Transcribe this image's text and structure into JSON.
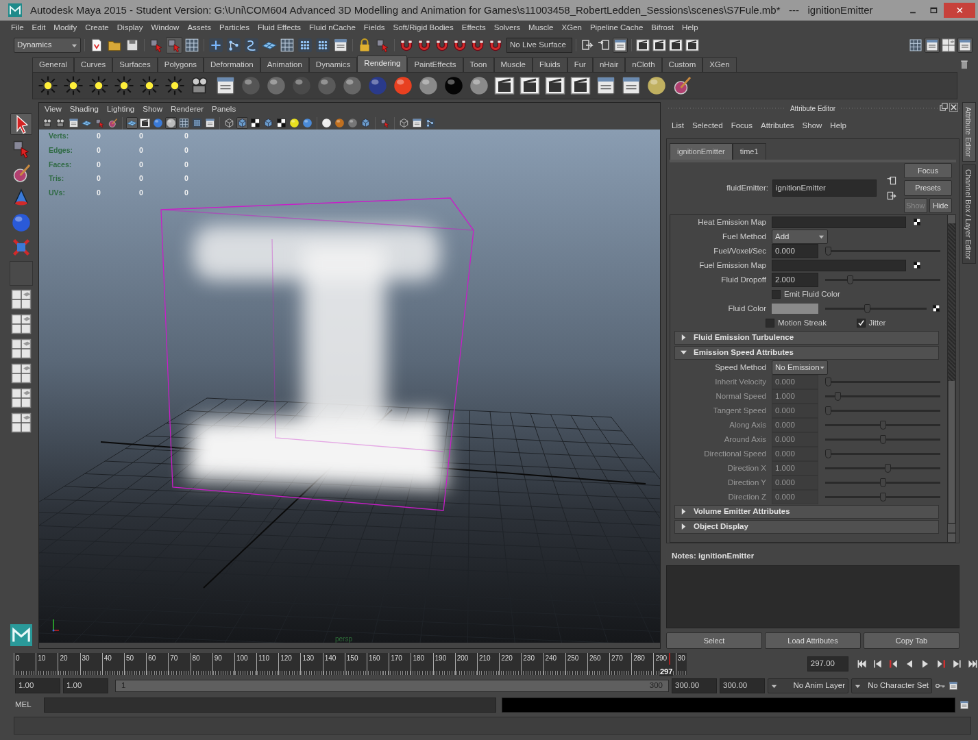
{
  "window": {
    "title": "Autodesk Maya 2015 - Student Version: G:\\Uni\\COM604 Advanced 3D Modelling and Animation for Games\\s11003458_RobertLedden_Sessions\\scenes\\S7Fule.mb*   ---   ignitionEmitter"
  },
  "menu": [
    "File",
    "Edit",
    "Modify",
    "Create",
    "Display",
    "Window",
    "Assets",
    "Particles",
    "Fluid Effects",
    "Fluid nCache",
    "Fields",
    "Soft/Rigid Bodies",
    "Effects",
    "Solvers",
    "Muscle",
    "XGen",
    "Pipeline Cache",
    "Bifrost",
    "Help"
  ],
  "status_line": {
    "menu_set": "Dynamics",
    "live_surface": "No Live Surface"
  },
  "shelf": {
    "tabs": [
      {
        "label": "General",
        "selected": false
      },
      {
        "label": "Curves",
        "selected": false
      },
      {
        "label": "Surfaces",
        "selected": false
      },
      {
        "label": "Polygons",
        "selected": false
      },
      {
        "label": "Deformation",
        "selected": false
      },
      {
        "label": "Animation",
        "selected": false
      },
      {
        "label": "Dynamics",
        "selected": false
      },
      {
        "label": "Rendering",
        "selected": true
      },
      {
        "label": "PaintEffects",
        "selected": false
      },
      {
        "label": "Toon",
        "selected": false
      },
      {
        "label": "Muscle",
        "selected": false
      },
      {
        "label": "Fluids",
        "selected": false
      },
      {
        "label": "Fur",
        "selected": false
      },
      {
        "label": "nHair",
        "selected": false
      },
      {
        "label": "nCloth",
        "selected": false
      },
      {
        "label": "Custom",
        "selected": false
      },
      {
        "label": "XGen",
        "selected": false
      }
    ]
  },
  "viewport": {
    "menu": [
      "View",
      "Shading",
      "Lighting",
      "Show",
      "Renderer",
      "Panels"
    ],
    "stats": [
      {
        "label": "Verts:",
        "values": [
          "0",
          "0",
          "0"
        ]
      },
      {
        "label": "Edges:",
        "values": [
          "0",
          "0",
          "0"
        ]
      },
      {
        "label": "Faces:",
        "values": [
          "0",
          "0",
          "0"
        ]
      },
      {
        "label": "Tris:",
        "values": [
          "0",
          "0",
          "0"
        ]
      },
      {
        "label": "UVs:",
        "values": [
          "0",
          "0",
          "0"
        ]
      }
    ],
    "camera": "persp"
  },
  "attribute_editor": {
    "title": "Attribute Editor",
    "menu": [
      "List",
      "Selected",
      "Focus",
      "Attributes",
      "Show",
      "Help"
    ],
    "tabs": [
      {
        "label": "ignitionEmitter",
        "selected": true
      },
      {
        "label": "time1",
        "selected": false
      }
    ],
    "node_label": "fluidEmitter:",
    "node_name": "ignitionEmitter",
    "buttons": [
      {
        "label": "Focus",
        "disabled": false
      },
      {
        "label": "Presets",
        "disabled": false
      },
      {
        "label": "Show",
        "disabled": true
      },
      {
        "label": "Hide",
        "disabled": false
      }
    ],
    "rows": [
      {
        "kind": "map",
        "label": "Heat Emission Map"
      },
      {
        "kind": "dropdown",
        "label": "Fuel Method",
        "value": "Add"
      },
      {
        "kind": "slider",
        "label": "Fuel/Voxel/Sec",
        "value": "0.000",
        "level": 0.0,
        "disabled": false
      },
      {
        "kind": "map",
        "label": "Fuel Emission Map"
      },
      {
        "kind": "slider",
        "label": "Fluid Dropoff",
        "value": "2.000",
        "level": 0.2,
        "disabled": false
      },
      {
        "kind": "checkboxes",
        "items": [
          {
            "label": "Emit Fluid Color",
            "checked": false
          }
        ]
      },
      {
        "kind": "color",
        "label": "Fluid Color",
        "level": 0.41
      },
      {
        "kind": "checkboxes",
        "items": [
          {
            "label": "Motion Streak",
            "checked": false
          },
          {
            "label": "Jitter",
            "checked": true
          }
        ]
      },
      {
        "kind": "section",
        "label": "Fluid Emission Turbulence",
        "expanded": false
      },
      {
        "kind": "section",
        "label": "Emission Speed Attributes",
        "expanded": true
      },
      {
        "kind": "dropdown",
        "label": "Speed Method",
        "value": "No Emission"
      },
      {
        "kind": "slider",
        "label": "Inherit Velocity",
        "value": "0.000",
        "level": 0.0,
        "disabled": true
      },
      {
        "kind": "slider",
        "label": "Normal Speed",
        "value": "1.000",
        "level": 0.09,
        "disabled": true
      },
      {
        "kind": "slider",
        "label": "Tangent Speed",
        "value": "0.000",
        "level": 0.0,
        "disabled": true
      },
      {
        "kind": "slider",
        "label": "Along Axis",
        "value": "0.000",
        "level": 0.5,
        "disabled": true
      },
      {
        "kind": "slider",
        "label": "Around Axis",
        "value": "0.000",
        "level": 0.5,
        "disabled": true
      },
      {
        "kind": "slider",
        "label": "Directional Speed",
        "value": "0.000",
        "level": 0.0,
        "disabled": true
      },
      {
        "kind": "slider",
        "label": "Direction X",
        "value": "1.000",
        "level": 0.55,
        "disabled": true
      },
      {
        "kind": "slider",
        "label": "Direction Y",
        "value": "0.000",
        "level": 0.5,
        "disabled": true
      },
      {
        "kind": "slider",
        "label": "Direction Z",
        "value": "0.000",
        "level": 0.5,
        "disabled": true
      },
      {
        "kind": "section",
        "label": "Volume Emitter Attributes",
        "expanded": false
      },
      {
        "kind": "section",
        "label": "Object Display",
        "expanded": false
      }
    ],
    "notes_label": "Notes:  ignitionEmitter",
    "bottom_buttons": [
      "Select",
      "Load Attributes",
      "Copy Tab"
    ]
  },
  "side_tabs": [
    {
      "label": "Attribute Editor",
      "selected": true
    },
    {
      "label": "Channel Box / Layer Editor",
      "selected": false
    }
  ],
  "timeline": {
    "ticks": [
      "0",
      "10",
      "20",
      "30",
      "40",
      "50",
      "60",
      "70",
      "80",
      "90",
      "100",
      "110",
      "120",
      "130",
      "140",
      "150",
      "160",
      "170",
      "180",
      "190",
      "200",
      "210",
      "220",
      "230",
      "240",
      "250",
      "260",
      "270",
      "280",
      "290",
      "30"
    ],
    "current_frame": "297",
    "level": 0.99,
    "current_field": "297.00"
  },
  "range": {
    "start": "1.00",
    "playback_start": "1.00",
    "slider_start": "1",
    "slider_end": "300",
    "playback_end": "300.00",
    "end": "300.00",
    "anim_layer": "No Anim Layer",
    "character_set": "No Character Set"
  },
  "command_line": {
    "label": "MEL"
  }
}
